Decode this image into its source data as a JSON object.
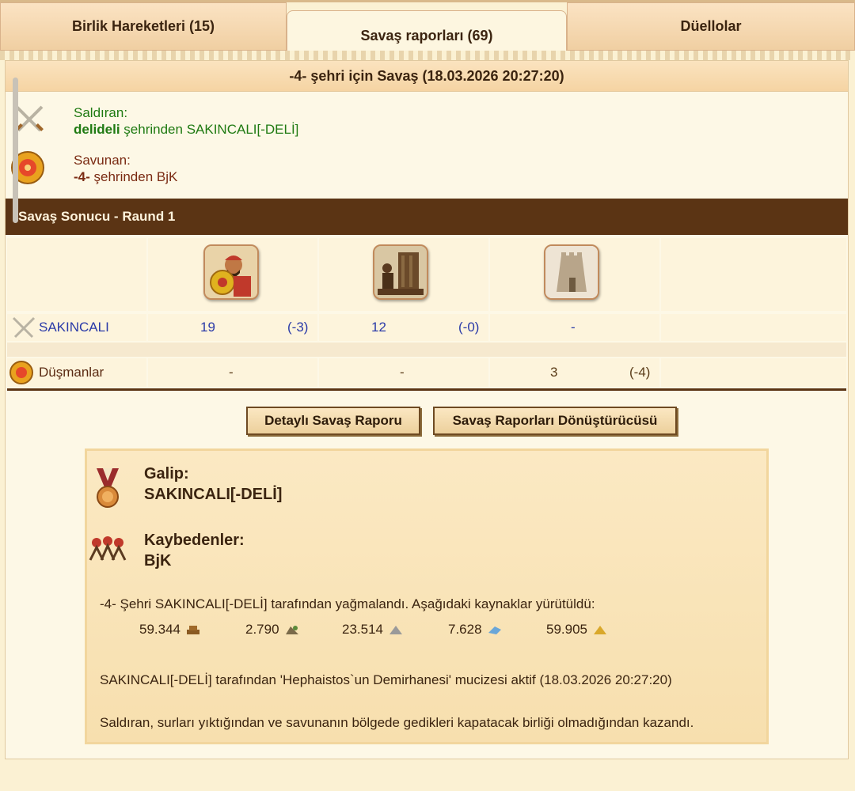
{
  "tabs": [
    {
      "label": "Birlik Hareketleri (15)"
    },
    {
      "label": "Savaş raporları (69)"
    },
    {
      "label": "Düellolar"
    }
  ],
  "report": {
    "title": "-4- şehri için Savaş (18.03.2026 20:27:20)",
    "attacker_label": "Saldıran:",
    "attacker_city": "delideli",
    "attacker_rest": " şehrinden SAKINCALI[-DELİ]",
    "defender_label": "Savunan:",
    "defender_city": "-4-",
    "defender_rest": " şehrinden BjK",
    "result_title": "Savaş Sonucu - Raund 1"
  },
  "units": [
    {
      "icon": "hoplite-unit-icon"
    },
    {
      "icon": "catapult-unit-icon"
    },
    {
      "icon": "wall-tower-unit-icon"
    }
  ],
  "rows": {
    "attacker": {
      "name": "SAKINCALI",
      "cells": [
        {
          "count": "19",
          "loss": "(-3)"
        },
        {
          "count": "12",
          "loss": "(-0)"
        },
        {
          "count": "-",
          "loss": ""
        }
      ]
    },
    "enemies": {
      "name": "Düşmanlar",
      "cells": [
        {
          "count": "-",
          "loss": ""
        },
        {
          "count": "-",
          "loss": ""
        },
        {
          "count": "3",
          "loss": "(-4)"
        }
      ]
    }
  },
  "buttons": {
    "detailed": "Detaylı Savaş Raporu",
    "converter": "Savaş Raporları Dönüştürücüsü"
  },
  "summary": {
    "winner_label": "Galip:",
    "winner_name": "SAKINCALI[-DELİ]",
    "losers_label": "Kaybedenler:",
    "losers_name": "BjK",
    "plunder_text": "-4- Şehri SAKINCALI[-DELİ] tarafından yağmalandı. Aşağıdaki kaynaklar yürütüldü:",
    "resources": [
      {
        "value": "59.344",
        "icon": "wood-icon"
      },
      {
        "value": "2.790",
        "icon": "stone-icon"
      },
      {
        "value": "23.514",
        "icon": "iron-icon"
      },
      {
        "value": "7.628",
        "icon": "favor-icon"
      },
      {
        "value": "59.905",
        "icon": "gold-icon"
      }
    ],
    "wonder_text": "SAKINCALI[-DELİ] tarafından 'Hephaistos`un Demirhanesi' mucizesi aktif (18.03.2026 20:27:20)",
    "reason_text": "Saldıran, surları yıktığından ve savunanın bölgede gedikleri kapatacak birliği olmadığından kazandı."
  },
  "colors": {
    "attacker_green": "#1f7a12",
    "defender_red": "#7a2a12",
    "header_brown": "#5b3414",
    "count_blue": "#2a3aa8"
  }
}
